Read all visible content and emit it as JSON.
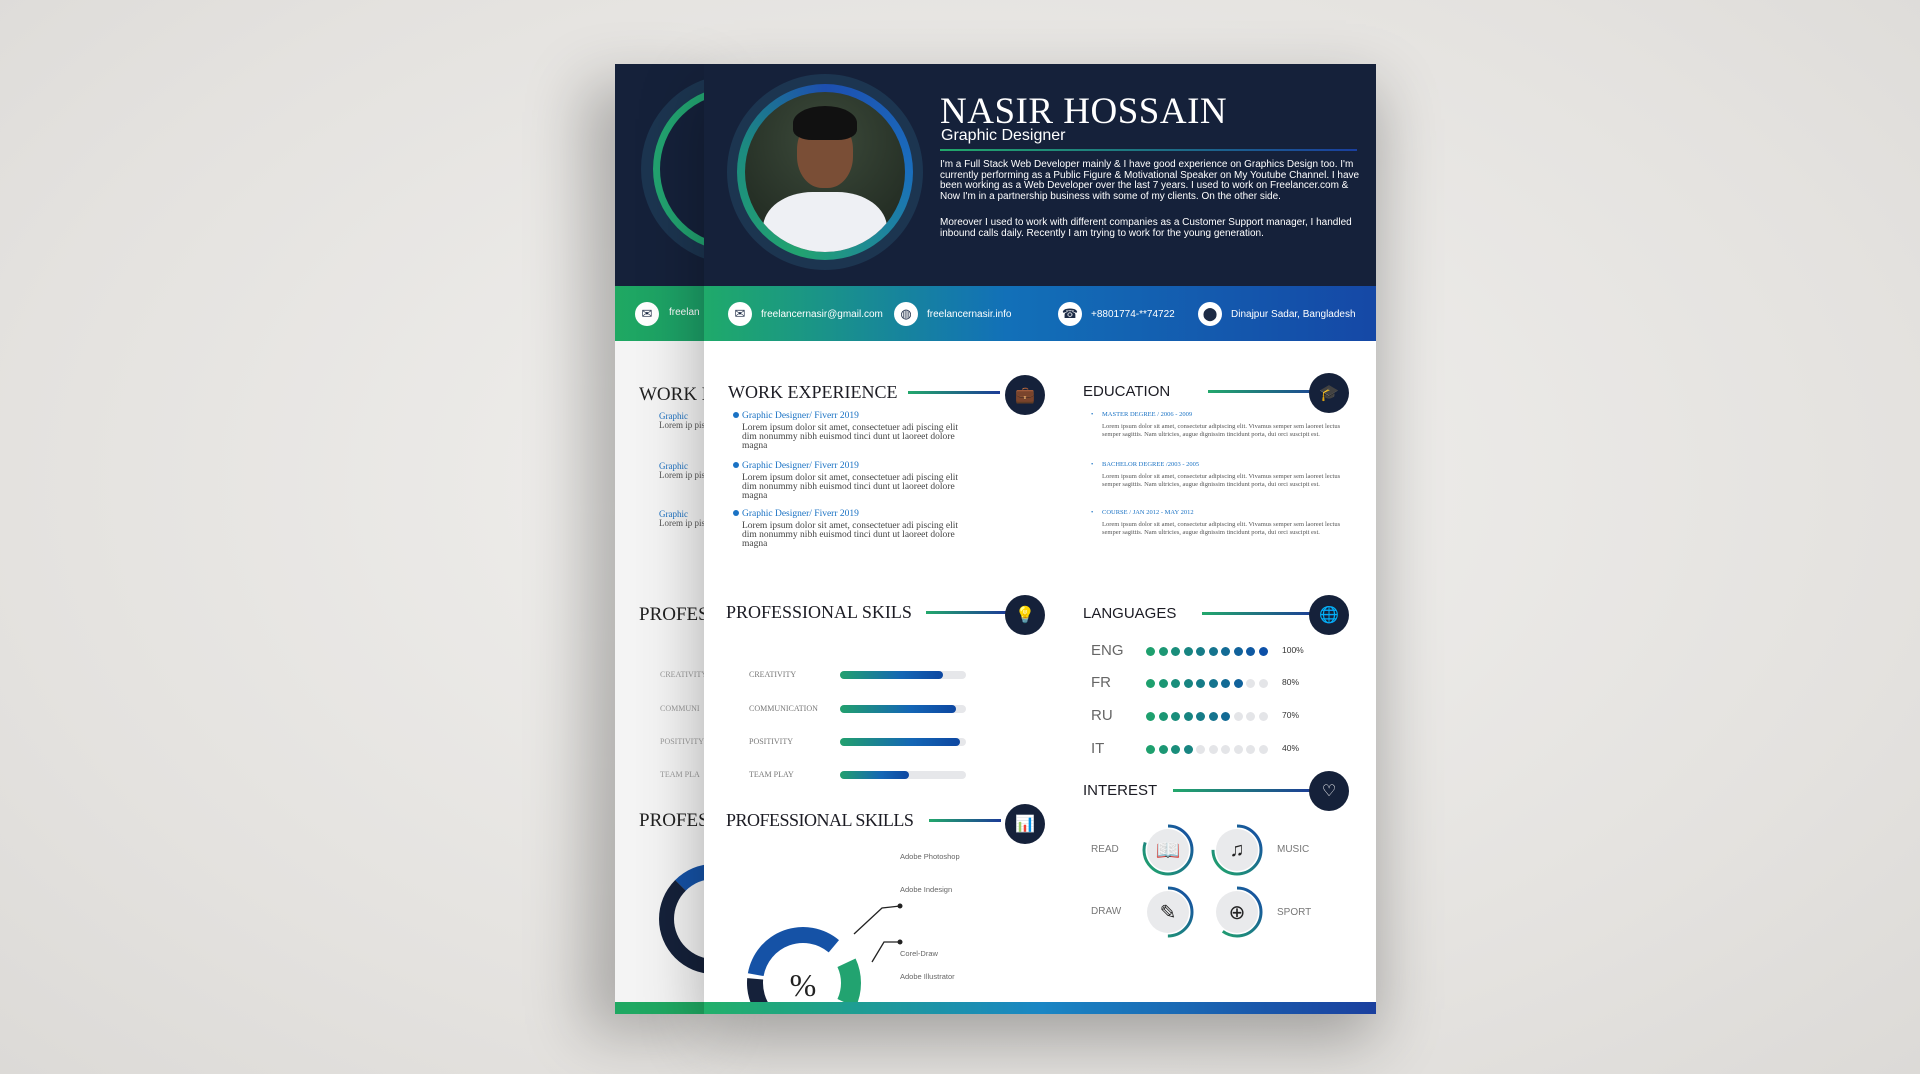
{
  "profile": {
    "name": "NASIR HOSSAIN",
    "role": "Graphic Designer",
    "bio1": "I'm a Full Stack Web Developer mainly & I have good experience on Graphics Design too. I'm currently performing as a Public Figure & Motivational Speaker on My Youtube Channel. I have been working as  a Web Developer over the last 7 years. I used to work on Freelancer.com & Now I'm in a partnership business with some of my clients. On the other side.",
    "bio2": "Moreover I used to work with different companies as a Customer Support manager, I handled inbound calls daily. Recently I am trying to work for the young generation."
  },
  "contact": [
    {
      "icon": "mail-icon",
      "text": "freelancernasir@gmail.com"
    },
    {
      "icon": "globe-icon",
      "text": "freelancernasir.info"
    },
    {
      "icon": "phone-icon",
      "text": "+8801774-**74722"
    },
    {
      "icon": "location-pin-icon",
      "text": "Dinajpur Sadar, Bangladesh"
    }
  ],
  "work": {
    "title": "WORK EXPERIENCE",
    "icon": "briefcase-icon",
    "items": [
      {
        "heading": "Graphic Designer/ Fiverr 2019",
        "body": "Lorem ipsum dolor sit amet, consectetuer adi piscing elit dim nonummy nibh euismod tinci dunt ut laoreet dolore magna"
      },
      {
        "heading": "Graphic Designer/ Fiverr 2019",
        "body": "Lorem ipsum dolor sit amet, consectetuer adi piscing elit dim nonummy nibh euismod tinci dunt ut laoreet dolore magna"
      },
      {
        "heading": "Graphic Designer/ Fiverr 2019",
        "body": "Lorem ipsum dolor sit amet, consectetuer adi piscing elit dim nonummy nibh euismod tinci dunt ut laoreet dolore magna"
      }
    ]
  },
  "education": {
    "title": "EDUCATION",
    "icon": "graduation-icon",
    "items": [
      {
        "heading": "MASTER DEGREE / 2006 - 2009",
        "body": "Lorem ipsum dolor sit amet, consectetur adipiscing elit. Vivamus semper sem laoreet lectus semper sagittis.  Nam ultricies, augue dignissim tincidunt porta, dui orci suscipit est."
      },
      {
        "heading": "BACHELOR DEGREE  /2003 - 2005",
        "body": "Lorem ipsum dolor sit amet, consectetur adipiscing elit. Vivamus semper sem laoreet lectus semper sagittis.  Nam ultricies, augue dignissim tincidunt porta, dui orci suscipit est."
      },
      {
        "heading": "COURSE / JAN 2012 - MAY 2012",
        "body": "Lorem ipsum dolor sit amet, consectetur adipiscing elit. Vivamus semper sem laoreet lectus semper sagittis.  Nam ultricies, augue dignissim tincidunt porta, dui orci suscipit est."
      }
    ]
  },
  "skills": {
    "title": "PROFESSIONAL SKILS",
    "icon": "lightbulb-cycle-icon",
    "items": [
      {
        "label": "CREATIVITY",
        "level": 0.82
      },
      {
        "label": "COMMUNICATION",
        "level": 0.92
      },
      {
        "label": "POSITIVITY",
        "level": 0.95
      },
      {
        "label": "TEAM PLAY",
        "level": 0.55
      }
    ]
  },
  "languages": {
    "title": "LANGUAGES",
    "icon": "globe-chat-icon",
    "items": [
      {
        "code": "ENG",
        "dots": 10,
        "percent": "100%"
      },
      {
        "code": "FR",
        "dots": 8,
        "percent": "80%"
      },
      {
        "code": "RU",
        "dots": 7,
        "percent": "70%"
      },
      {
        "code": "IT",
        "dots": 4,
        "percent": "40%"
      }
    ]
  },
  "software": {
    "title": "PROFESSIONAL SKILLS",
    "icon": "bar-chart-icon",
    "center": "%",
    "items": [
      {
        "label": "Adobe Photoshop",
        "color": "#1552a6"
      },
      {
        "label": "Adobe Indesign",
        "color": "#22a370"
      },
      {
        "label": "Corel-Draw",
        "color": "#1672c0"
      },
      {
        "label": "Adobe Illustrator",
        "color": "#15213a"
      }
    ]
  },
  "interest": {
    "title": "INTEREST",
    "icon": "heart-icon",
    "items": [
      {
        "label": "READ",
        "icon": "book-icon"
      },
      {
        "label": "MUSIC",
        "icon": "music-note-icon"
      },
      {
        "label": "DRAW",
        "icon": "pencil-icon"
      },
      {
        "label": "SPORT",
        "icon": "basketball-icon"
      }
    ]
  },
  "back_card": {
    "contact": "freelan",
    "work_title": "WORK E",
    "skills_title": "PROFES",
    "software_title": "PROFES",
    "skill_labels": [
      "CREATIVITY",
      "COMMUNI",
      "POSITIVITY",
      "TEAM PLA"
    ],
    "item_heading": "Graphic",
    "item_body": "Lorem ip piscing e dunt ut l"
  },
  "colors": {
    "navy": "#15213a",
    "green": "#22a86a",
    "blue": "#1548a6",
    "accent_text": "#1a72c4"
  }
}
